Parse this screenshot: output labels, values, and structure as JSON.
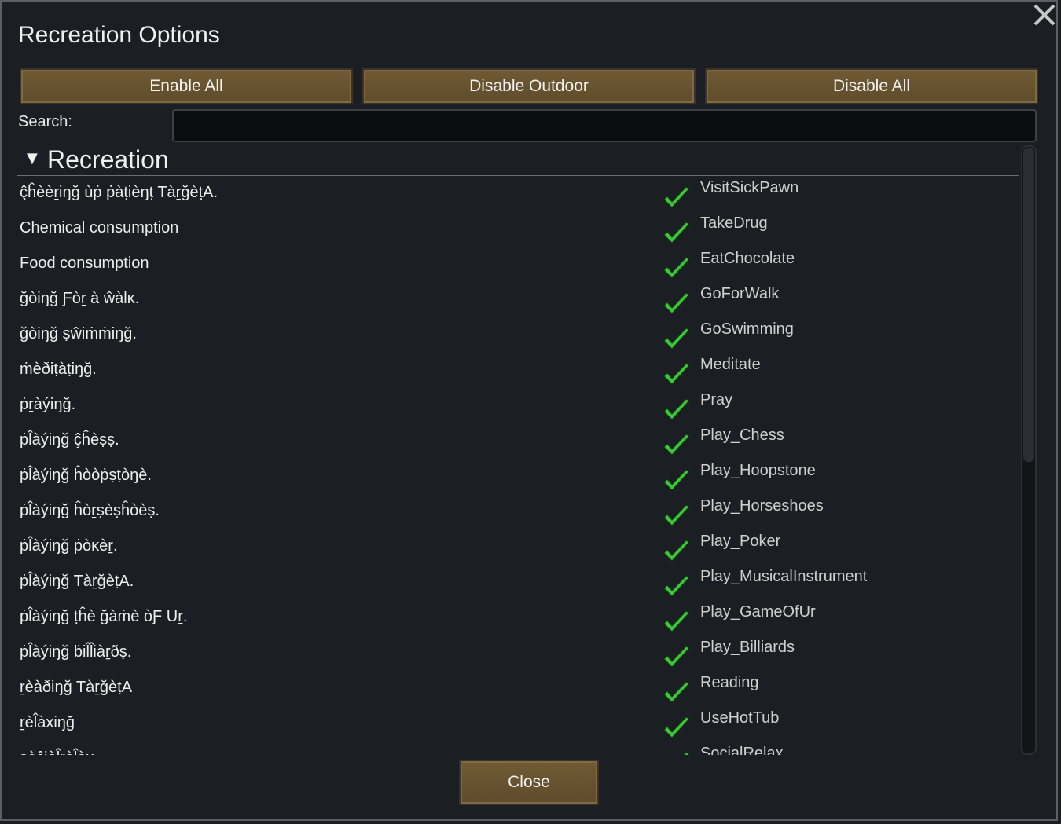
{
  "dialog": {
    "title": "Recreation Options",
    "close_icon": "close-x-icon"
  },
  "toolbar": {
    "enable_all": "Enable All",
    "disable_outdoor": "Disable Outdoor",
    "disable_all": "Disable All"
  },
  "search": {
    "label": "Search:",
    "value": "",
    "placeholder": ""
  },
  "group": {
    "title": "Recreation",
    "expanded": true,
    "icon": "triangle-down-icon"
  },
  "rows": [
    {
      "label": "ç̂ĥèèṟiŋğ ùṗ ṗàṭièŋṭ TàṟğèṭA.",
      "def": "VisitSickPawn",
      "enabled": true
    },
    {
      "label": "Chemical consumption",
      "def": "TakeDrug",
      "enabled": true
    },
    {
      "label": "Food consumption",
      "def": "EatChocolate",
      "enabled": true
    },
    {
      "label": "ğòiŋğ Ƒòṟ à ŵàlĸ.",
      "def": "GoForWalk",
      "enabled": true
    },
    {
      "label": "ğòiŋğ ṣŵiṁṁiŋğ.",
      "def": "GoSwimming",
      "enabled": true
    },
    {
      "label": "ṁèðiṭàṭiŋğ.",
      "def": "Meditate",
      "enabled": true
    },
    {
      "label": "ṗṟàýiŋğ.",
      "def": "Pray",
      "enabled": true
    },
    {
      "label": "ṗl̂àýiŋğ ç̂ĥèṣṣ.",
      "def": "Play_Chess",
      "enabled": true
    },
    {
      "label": "ṗl̂àýiŋğ ĥòòṗṣṭòŋè.",
      "def": "Play_Hoopstone",
      "enabled": true
    },
    {
      "label": "ṗl̂àýiŋğ ĥòṟṣèṣĥòèṣ.",
      "def": "Play_Horseshoes",
      "enabled": true
    },
    {
      "label": "ṗl̂àýiŋğ ṗòĸèṟ.",
      "def": "Play_Poker",
      "enabled": true
    },
    {
      "label": "ṗl̂àýiŋğ TàṟğèṭA.",
      "def": "Play_MusicalInstrument",
      "enabled": true
    },
    {
      "label": "ṗl̂àýiŋğ ṭĥè ğàṁè òƑ Uṟ.",
      "def": "Play_GameOfUr",
      "enabled": true
    },
    {
      "label": "ṗl̂àýiŋğ ḃil̂l̂iàṟðṣ.",
      "def": "Play_Billiards",
      "enabled": true
    },
    {
      "label": "ṟèàðiŋğ TàṟğèṭA",
      "def": "Reading",
      "enabled": true
    },
    {
      "label": "ṟèl̂àxiŋğ",
      "def": "UseHotTub",
      "enabled": true
    },
    {
      "label": "ṣòç̂iàl̂ṟèl̂àx",
      "def": "SocialRelax",
      "enabled": true
    }
  ],
  "footer": {
    "close": "Close"
  },
  "colors": {
    "button_fill": "#6a5630",
    "check_green": "#3ec63a",
    "background": "#1b1e22"
  }
}
